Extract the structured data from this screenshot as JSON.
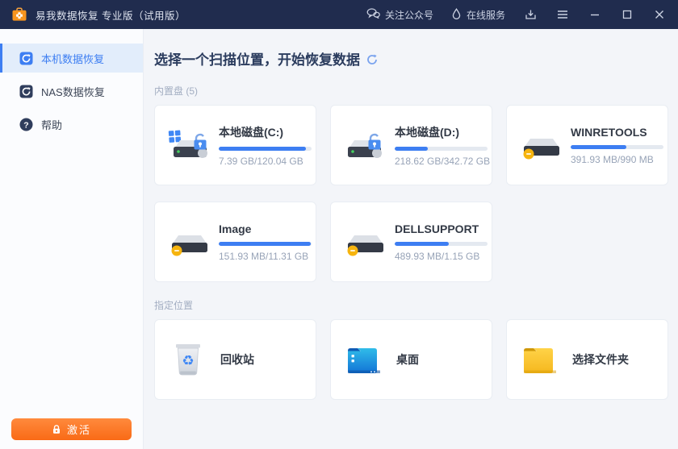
{
  "titlebar": {
    "app_title": "易我数据恢复 专业版（试用版）",
    "follow": "关注公众号",
    "service": "在线服务"
  },
  "sidebar": {
    "items": [
      {
        "label": "本机数据恢复",
        "active": true
      },
      {
        "label": "NAS数据恢复",
        "active": false
      },
      {
        "label": "帮助",
        "active": false
      }
    ],
    "activate": "激活"
  },
  "main": {
    "title": "选择一个扫描位置，开始恢复数据",
    "section_drives": "内置盘 (5)",
    "section_locations": "指定位置",
    "drives": [
      {
        "name": "本地磁盘(C:)",
        "size": "7.39 GB/120.04 GB",
        "used_pct": 94,
        "icon": "drive-windows-bitlocker-icon"
      },
      {
        "name": "本地磁盘(D:)",
        "size": "218.62 GB/342.72 GB",
        "used_pct": 36,
        "icon": "drive-bitlocker-icon"
      },
      {
        "name": "WINRETOOLS",
        "size": "391.93 MB/990 MB",
        "used_pct": 60,
        "icon": "drive-yellow-badge-icon"
      },
      {
        "name": "Image",
        "size": "151.93 MB/11.31 GB",
        "used_pct": 99,
        "icon": "drive-yellow-badge-icon"
      },
      {
        "name": "DELLSUPPORT",
        "size": "489.93 MB/1.15 GB",
        "used_pct": 58,
        "icon": "drive-yellow-badge-icon"
      }
    ],
    "locations": [
      {
        "label": "回收站"
      },
      {
        "label": "桌面"
      },
      {
        "label": "选择文件夹"
      }
    ]
  },
  "colors": {
    "titlebar_bg": "#202c4e",
    "accent_blue": "#3d7ef2",
    "progress_fill": "#3d7ef2",
    "activate_orange": "#f96a16",
    "badge_yellow": "#f6b40e",
    "main_bg": "#f3f5f9"
  }
}
